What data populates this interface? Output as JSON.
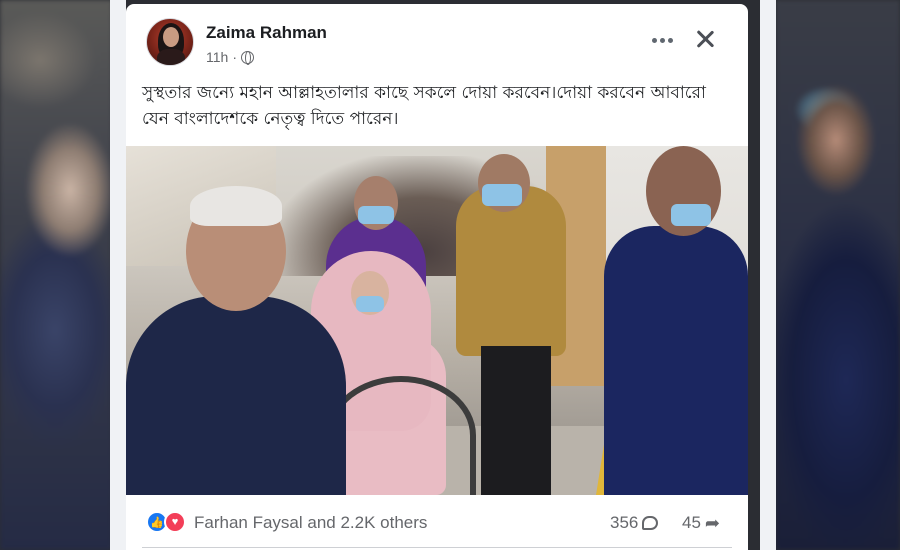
{
  "post": {
    "author": "Zaima Rahman",
    "time": "11h",
    "privacy_icon": "globe-icon",
    "text": "সুস্থতার জন্যে মহান আল্লাহতালার কাছে সকলে দোয়া করবেন।দোয়া করবেন আবারো যেন বাংলাদেশকে নেতৃত্ব দিতে পারেন।",
    "menu_icon": "more-options-icon",
    "close_icon": "close-icon"
  },
  "reactions": {
    "icons": [
      "like-icon",
      "love-icon"
    ],
    "summary": "Farhan Faysal and 2.2K others",
    "comments": "356",
    "shares": "45"
  },
  "colors": {
    "accent": "#1877f2",
    "love": "#f33e58",
    "text_primary": "#1c1e21",
    "text_secondary": "#65676b"
  }
}
